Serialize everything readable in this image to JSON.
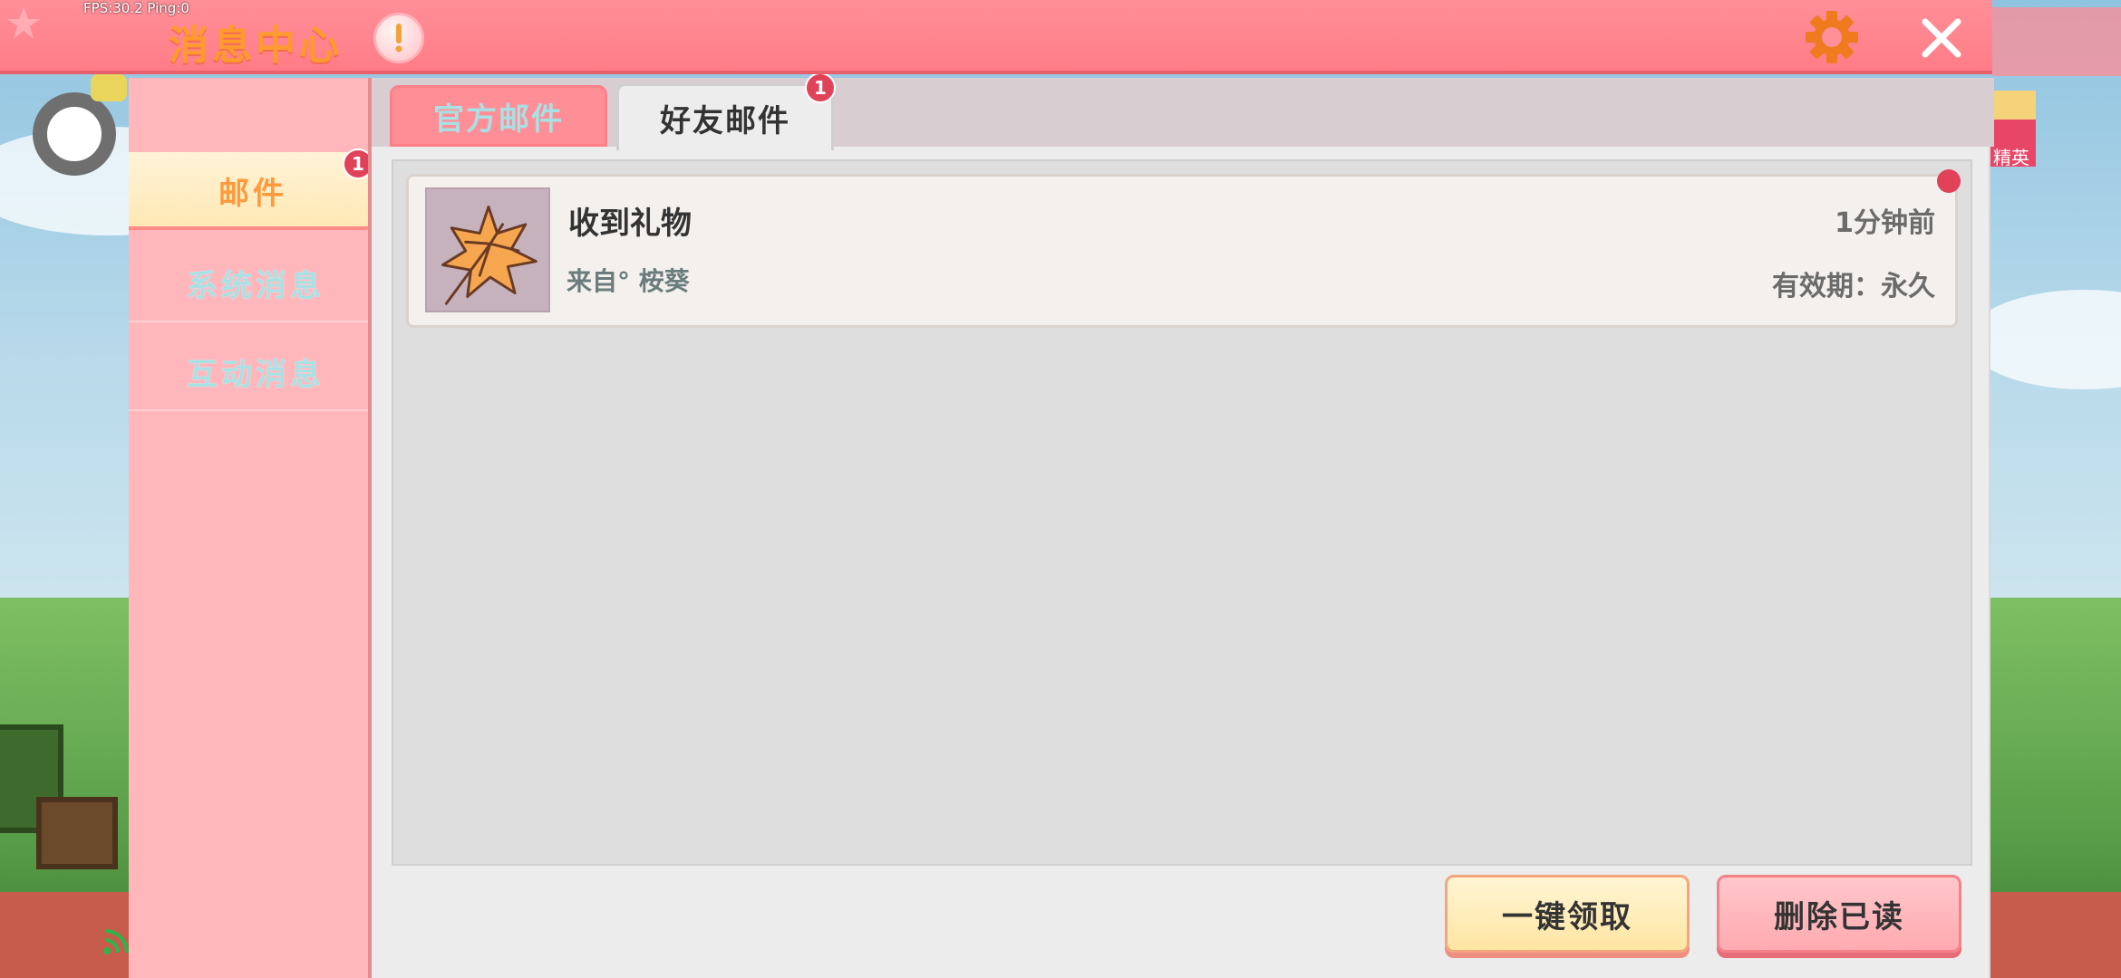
{
  "overlay": {
    "fps_text": "FPS:30.2  Ping:0"
  },
  "header": {
    "title": "消息中心",
    "icons": {
      "info": "exclamation-icon",
      "settings": "gear-icon",
      "close": "close-icon"
    }
  },
  "sidebar": {
    "items": [
      {
        "label": "邮件",
        "badge": "1",
        "active": true
      },
      {
        "label": "系统消息",
        "active": false
      },
      {
        "label": "互动消息",
        "active": false
      }
    ]
  },
  "tabs": [
    {
      "label": "官方邮件",
      "active": false
    },
    {
      "label": "好友邮件",
      "active": true,
      "badge": "1"
    }
  ],
  "mail_list": [
    {
      "icon": "maple-leaf-icon",
      "subject": "收到礼物",
      "from": "来自° 桉葵",
      "time": "1分钟前",
      "expiry": "有效期：永久",
      "unread": true
    }
  ],
  "actions": {
    "claim_all": "一键领取",
    "delete_read": "删除已读"
  },
  "background": {
    "right_tag": "精英"
  },
  "colors": {
    "header_pink": "#ff8f98",
    "sidebar_pink": "#ffb7bc",
    "active_orange": "#ff9a3c",
    "badge_red": "#e0425a",
    "inactive_cyan": "#a9e0e4"
  }
}
